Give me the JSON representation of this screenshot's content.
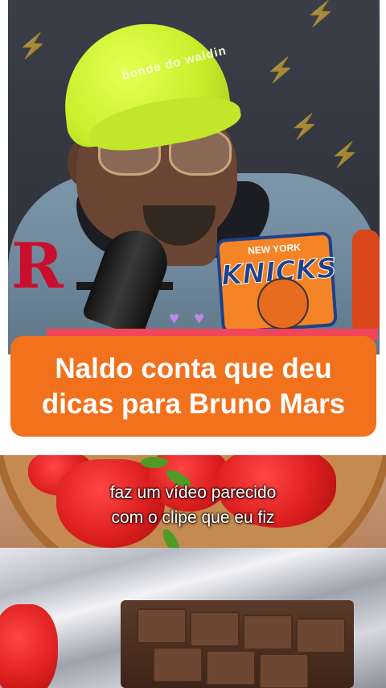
{
  "top_video": {
    "cap_text": "bonde do waldin",
    "jersey_team_top": "NEW YORK",
    "jersey_team_name": "KNICKS"
  },
  "headline": {
    "line1": "Naldo conta que deu",
    "line2": "dicas para Bruno Mars",
    "background_color": "#f2711c"
  },
  "bottom_video": {
    "subtitle_line1": "faz um vídeo parecido",
    "subtitle_line2": "com o clipe que eu fiz"
  }
}
